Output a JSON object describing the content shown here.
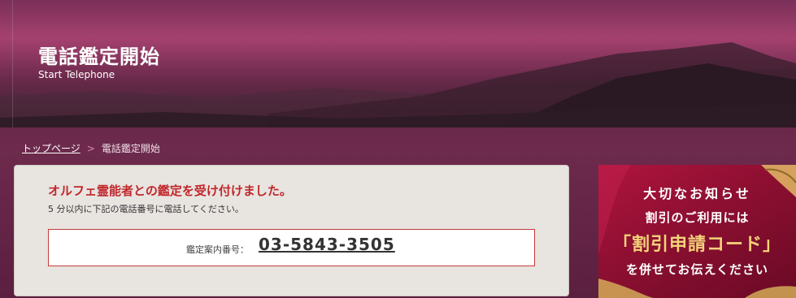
{
  "hero": {
    "title": "電話鑑定開始",
    "subtitle": "Start Telephone"
  },
  "breadcrumb": {
    "home": "トップページ",
    "separator": ">",
    "current": "電話鑑定開始"
  },
  "panel": {
    "heading": "オルフェ霊能者との鑑定を受け付けました。",
    "note": "5 分以内に下記の電話番号に電話してください。",
    "phone_label": "鑑定案内番号：",
    "phone_number": "03-5843-3505"
  },
  "promo": {
    "line1": "大切なお知らせ",
    "line2": "割引のご利用には",
    "line3": "「割引申請コード」",
    "line4": "を併せてお伝えください"
  },
  "colors": {
    "accent_red": "#c0262b",
    "page_bg": "#6d2a4c",
    "promo_gold": "#f3d27a"
  }
}
